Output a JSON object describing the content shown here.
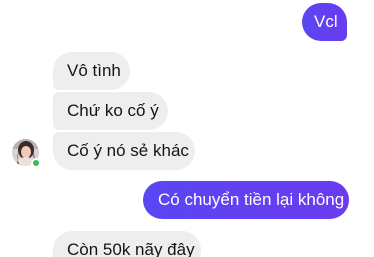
{
  "messages": [
    {
      "direction": "outgoing",
      "text": "Vcl"
    },
    {
      "direction": "incoming",
      "text": "Vô tình"
    },
    {
      "direction": "incoming",
      "text": "Chứ ko cố ý"
    },
    {
      "direction": "incoming",
      "text": "Cố ý nó sẻ khác"
    },
    {
      "direction": "outgoing",
      "text": "Có chuyển tiền lại không"
    },
    {
      "direction": "incoming",
      "text": "Còn 50k nãy đây"
    }
  ],
  "contact": {
    "avatar_icon": "contact-avatar-photo",
    "status": "online",
    "status_color": "#31c24d"
  },
  "colors": {
    "outgoing_bubble": "#5c3ff5",
    "incoming_bubble": "#eeeef1",
    "outgoing_text": "#ffffff",
    "incoming_text": "#151515"
  }
}
